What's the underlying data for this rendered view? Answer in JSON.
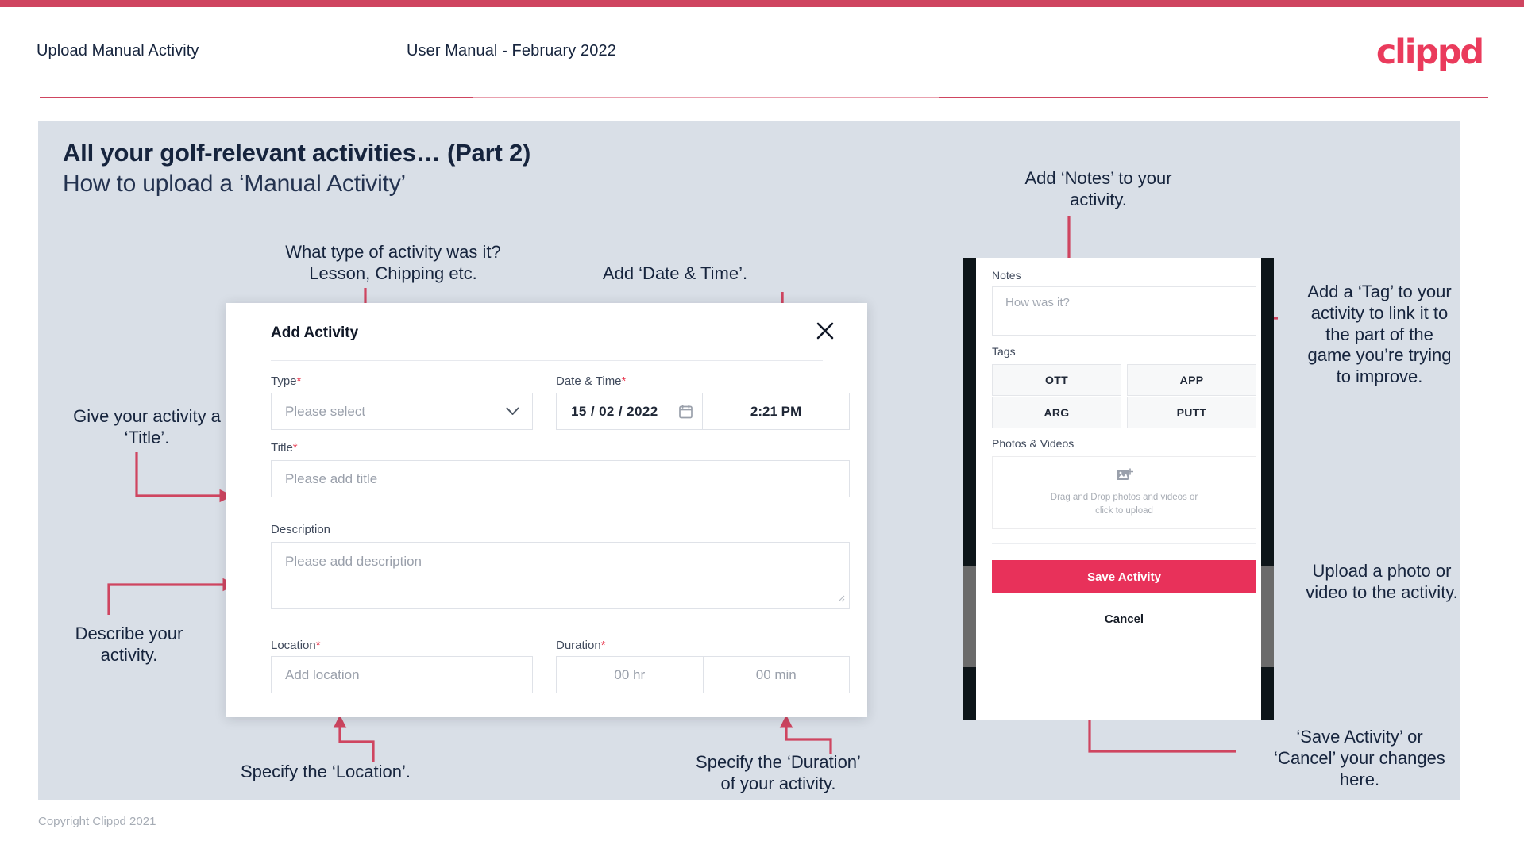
{
  "header": {
    "title": "Upload Manual Activity",
    "subtitle": "User Manual - February 2022",
    "logo": "clippd"
  },
  "slide": {
    "title": "All your golf-relevant activities… (Part 2)",
    "subtitle": "How to upload a ‘Manual Activity’"
  },
  "footer": {
    "copyright": "Copyright Clippd 2021"
  },
  "modal": {
    "title": "Add Activity",
    "close_icon": "close-icon",
    "fields": {
      "type": {
        "label": "Type",
        "required": "*",
        "placeholder": "Please select"
      },
      "datetime": {
        "label": "Date & Time",
        "required": "*",
        "day": "15",
        "sep1": "/",
        "month": "02",
        "sep2": "/",
        "year": "2022",
        "date_display": "15 /  02  / 2022",
        "time": "2:21 PM"
      },
      "title": {
        "label": "Title",
        "required": "*",
        "placeholder": "Please add title"
      },
      "description": {
        "label": "Description",
        "placeholder": "Please add description"
      },
      "location": {
        "label": "Location",
        "required": "*",
        "placeholder": "Add location"
      },
      "duration": {
        "label": "Duration",
        "required": "*",
        "hours": "00 hr",
        "minutes": "00 min"
      }
    }
  },
  "phone": {
    "notes": {
      "label": "Notes",
      "placeholder": "How was it?"
    },
    "tags": {
      "label": "Tags",
      "items": [
        "OTT",
        "APP",
        "ARG",
        "PUTT"
      ]
    },
    "photos": {
      "label": "Photos & Videos",
      "icon": "add-image-icon",
      "line1": "Drag and Drop photos and videos or",
      "line2": "click to upload"
    },
    "save_label": "Save Activity",
    "cancel_label": "Cancel"
  },
  "annotations": {
    "type": "What type of activity was it?\nLesson, Chipping etc.",
    "datetime": "Add ‘Date & Time’.",
    "title": "Give your activity a\n‘Title’.",
    "description": "Describe your\nactivity.",
    "location": "Specify the ‘Location’.",
    "duration": "Specify the ‘Duration’\nof your activity.",
    "notes": "Add ‘Notes’ to your\nactivity.",
    "tags": "Add a ‘Tag’ to your\nactivity to link it to\nthe part of the\ngame you’re trying\nto improve.",
    "upload": "Upload a photo or\nvideo to the activity.",
    "save": "‘Save Activity’ or\n‘Cancel’ your changes\nhere."
  },
  "colors": {
    "brand_pink": "#e8315a",
    "bar_red": "#cf4560",
    "arrow_red": "#cf4560",
    "slide_bg": "#d9dfe7",
    "ink": "#16243d"
  }
}
